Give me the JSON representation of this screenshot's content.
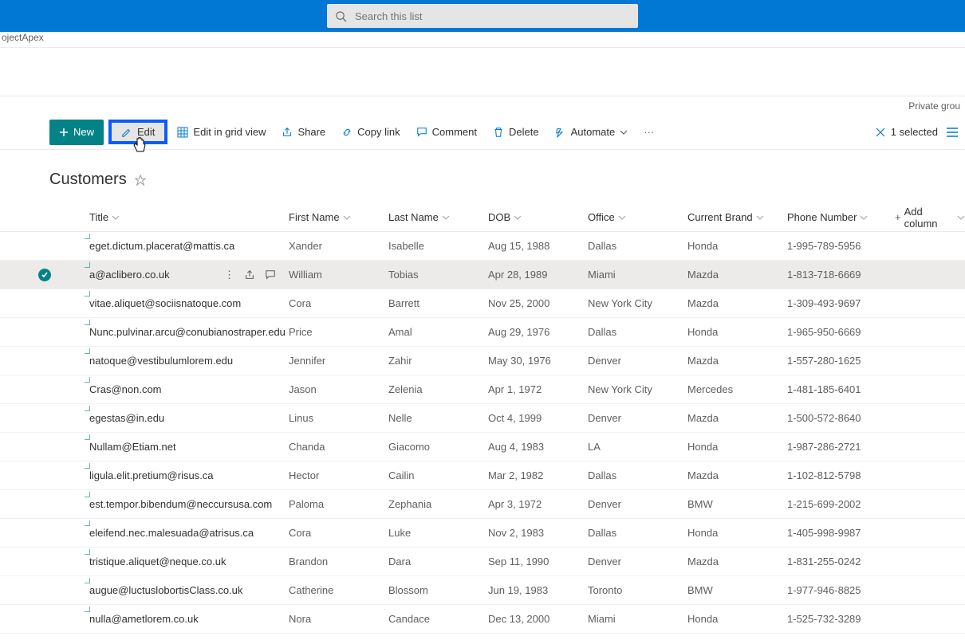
{
  "search": {
    "placeholder": "Search this list"
  },
  "breadcrumb": "ojectApex",
  "right_meta": "Private grou",
  "commands": {
    "new": "New",
    "edit": "Edit",
    "edit_grid": "Edit in grid view",
    "share": "Share",
    "copylink": "Copy link",
    "comment": "Comment",
    "delete": "Delete",
    "automate": "Automate",
    "selected": "1 selected"
  },
  "list": {
    "title": "Customers"
  },
  "columns": {
    "title": "Title",
    "first": "First Name",
    "last": "Last Name",
    "dob": "DOB",
    "office": "Office",
    "brand": "Current Brand",
    "phone": "Phone Number",
    "add": "Add column"
  },
  "rows": [
    {
      "title": "eget.dictum.placerat@mattis.ca",
      "first": "Xander",
      "last": "Isabelle",
      "dob": "Aug 15, 1988",
      "office": "Dallas",
      "brand": "Honda",
      "phone": "1-995-789-5956"
    },
    {
      "title": "a@aclibero.co.uk",
      "first": "William",
      "last": "Tobias",
      "dob": "Apr 28, 1989",
      "office": "Miami",
      "brand": "Mazda",
      "phone": "1-813-718-6669",
      "selected": true
    },
    {
      "title": "vitae.aliquet@sociisnatoque.com",
      "first": "Cora",
      "last": "Barrett",
      "dob": "Nov 25, 2000",
      "office": "New York City",
      "brand": "Mazda",
      "phone": "1-309-493-9697"
    },
    {
      "title": "Nunc.pulvinar.arcu@conubianostraper.edu",
      "first": "Price",
      "last": "Amal",
      "dob": "Aug 29, 1976",
      "office": "Dallas",
      "brand": "Honda",
      "phone": "1-965-950-6669"
    },
    {
      "title": "natoque@vestibulumlorem.edu",
      "first": "Jennifer",
      "last": "Zahir",
      "dob": "May 30, 1976",
      "office": "Denver",
      "brand": "Mazda",
      "phone": "1-557-280-1625"
    },
    {
      "title": "Cras@non.com",
      "first": "Jason",
      "last": "Zelenia",
      "dob": "Apr 1, 1972",
      "office": "New York City",
      "brand": "Mercedes",
      "phone": "1-481-185-6401"
    },
    {
      "title": "egestas@in.edu",
      "first": "Linus",
      "last": "Nelle",
      "dob": "Oct 4, 1999",
      "office": "Denver",
      "brand": "Mazda",
      "phone": "1-500-572-8640"
    },
    {
      "title": "Nullam@Etiam.net",
      "first": "Chanda",
      "last": "Giacomo",
      "dob": "Aug 4, 1983",
      "office": "LA",
      "brand": "Honda",
      "phone": "1-987-286-2721"
    },
    {
      "title": "ligula.elit.pretium@risus.ca",
      "first": "Hector",
      "last": "Cailin",
      "dob": "Mar 2, 1982",
      "office": "Dallas",
      "brand": "Mazda",
      "phone": "1-102-812-5798"
    },
    {
      "title": "est.tempor.bibendum@neccursusa.com",
      "first": "Paloma",
      "last": "Zephania",
      "dob": "Apr 3, 1972",
      "office": "Denver",
      "brand": "BMW",
      "phone": "1-215-699-2002"
    },
    {
      "title": "eleifend.nec.malesuada@atrisus.ca",
      "first": "Cora",
      "last": "Luke",
      "dob": "Nov 2, 1983",
      "office": "Dallas",
      "brand": "Honda",
      "phone": "1-405-998-9987"
    },
    {
      "title": "tristique.aliquet@neque.co.uk",
      "first": "Brandon",
      "last": "Dara",
      "dob": "Sep 11, 1990",
      "office": "Denver",
      "brand": "Mazda",
      "phone": "1-831-255-0242"
    },
    {
      "title": "augue@luctuslobortisClass.co.uk",
      "first": "Catherine",
      "last": "Blossom",
      "dob": "Jun 19, 1983",
      "office": "Toronto",
      "brand": "BMW",
      "phone": "1-977-946-8825"
    },
    {
      "title": "nulla@ametlorem.co.uk",
      "first": "Nora",
      "last": "Candace",
      "dob": "Dec 13, 2000",
      "office": "Miami",
      "brand": "Honda",
      "phone": "1-525-732-3289"
    }
  ]
}
